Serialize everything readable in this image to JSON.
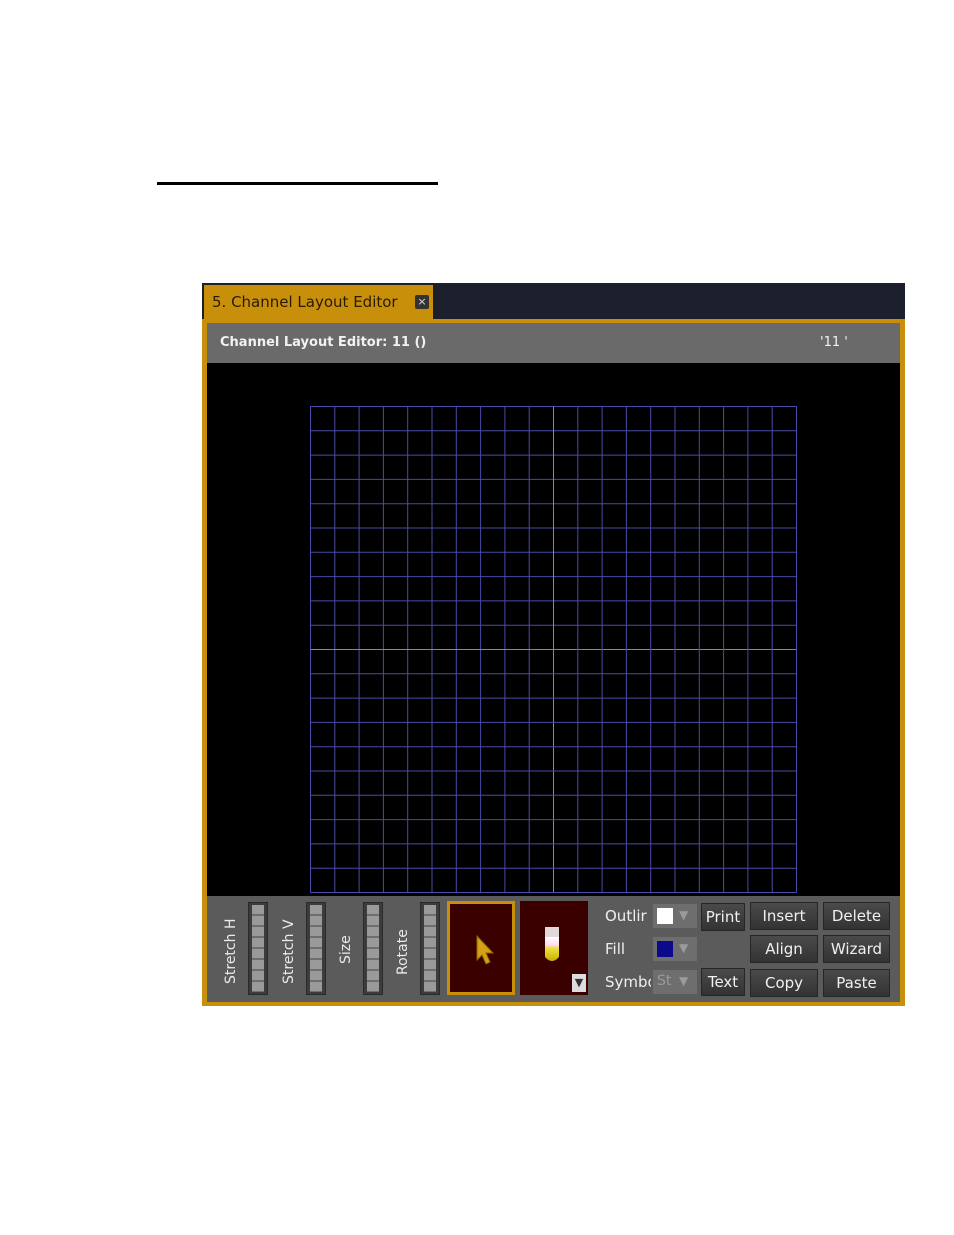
{
  "window": {
    "tab_label": "5. Channel Layout Editor",
    "tab_close_glyph": "×",
    "header_title": "Channel Layout Editor: 11 ()",
    "header_id": "'11 '"
  },
  "toolbar": {
    "faders": [
      {
        "label": "Stretch H"
      },
      {
        "label": "Stretch V"
      },
      {
        "label": "Size"
      },
      {
        "label": "Rotate"
      }
    ],
    "tools": [
      {
        "name": "pointer",
        "icon": "cursor-arrow-icon"
      },
      {
        "name": "lamp",
        "icon": "lamp-fixture-icon"
      }
    ],
    "dropdown_arrow": "▼",
    "properties": {
      "outline_label": "Outlir",
      "outline_color": "#ffffff",
      "fill_label": "Fill",
      "fill_color": "#0a0a8a",
      "symbol_label": "Symbo",
      "symbol_value": "St",
      "arrow_glyph": "▼"
    },
    "buttons": {
      "print": "Print",
      "text": "Text",
      "insert": "Insert",
      "delete": "Delete",
      "align": "Align",
      "wizard": "Wizard",
      "copy": "Copy",
      "paste": "Paste"
    }
  },
  "colors": {
    "accent": "#c8900a",
    "grid_line": "#4a4aa8",
    "grid_axis": "#7a7aff"
  }
}
